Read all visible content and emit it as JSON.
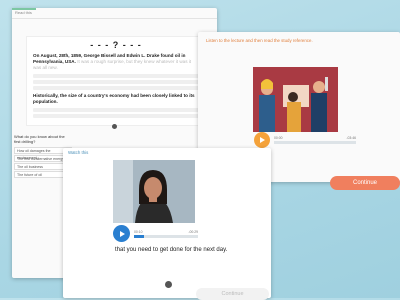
{
  "reading": {
    "header_label": "Read this",
    "title": "- - - ? - - -",
    "para1_bold": "On August, 28th, 1859, George Bissell and Edwin L. Drake found oil in Pennsylvania, USA.",
    "para1_rest": "It was a rough surprise, but they knew whatever it was it was all new.",
    "para2_bold": "Historically, the size of a country's economy had been closely linked to its population.",
    "question": "What do you know about the first drilling?",
    "options": [
      "How oil damages the environment",
      "The first oil/alternative energy",
      "The oil business",
      "The future of oil"
    ]
  },
  "listen": {
    "instruction": "Listen to the lecture and then read the study reference.",
    "time_start": "00:00",
    "time_end": "-03:46",
    "continue_label": "Continue"
  },
  "watch": {
    "header_label": "Watch this",
    "time_start": "00:10",
    "time_end": "-00:29",
    "caption": "that you need to get done for the next day.",
    "continue_label": "Continue"
  },
  "colors": {
    "accent_orange": "#f07f5e",
    "play_blue": "#2a7fd0",
    "play_orange": "#f4a23a"
  }
}
